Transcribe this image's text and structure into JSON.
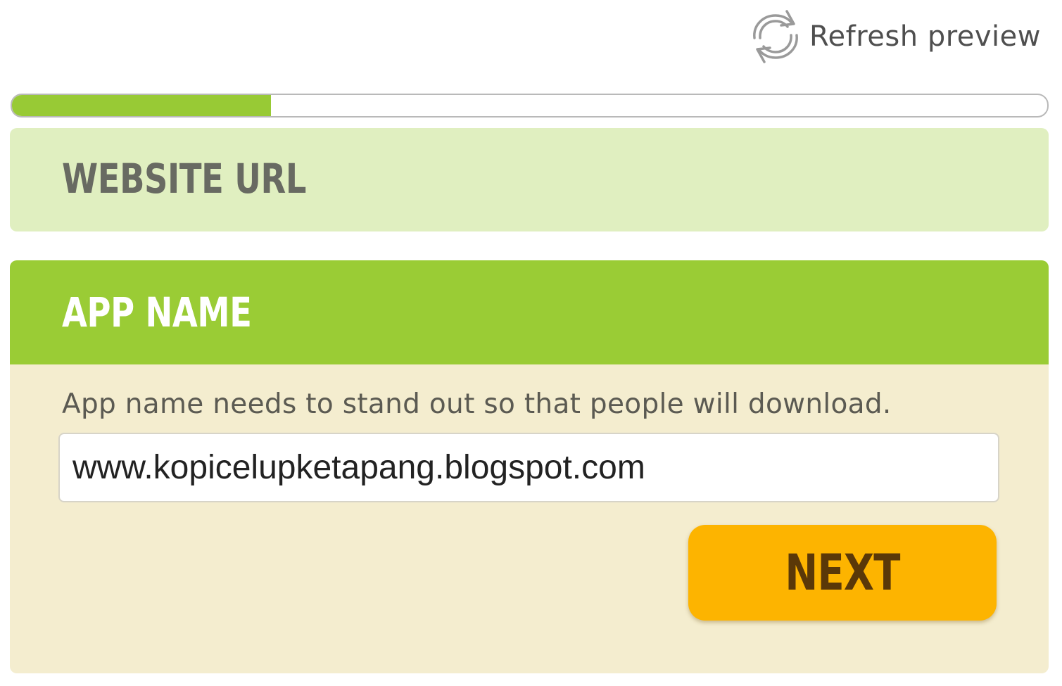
{
  "header": {
    "refresh_label": "Refresh preview",
    "refresh_icon": "refresh-icon"
  },
  "progress": {
    "fraction": 0.25,
    "fill_color": "#98ca35"
  },
  "steps": {
    "website_url": {
      "title": "WEBSITE URL"
    },
    "app_name": {
      "title": "APP NAME",
      "description": "App name needs to stand out so that people will download.",
      "input_value": "www.kopicelupketapang.blogspot.com",
      "next_label": "NEXT"
    }
  },
  "colors": {
    "accent_green": "#9acc35",
    "collapsed_green": "#e0efc0",
    "panel_cream": "#f4edcf",
    "button_orange": "#fdb400",
    "button_text": "#5a3808"
  }
}
